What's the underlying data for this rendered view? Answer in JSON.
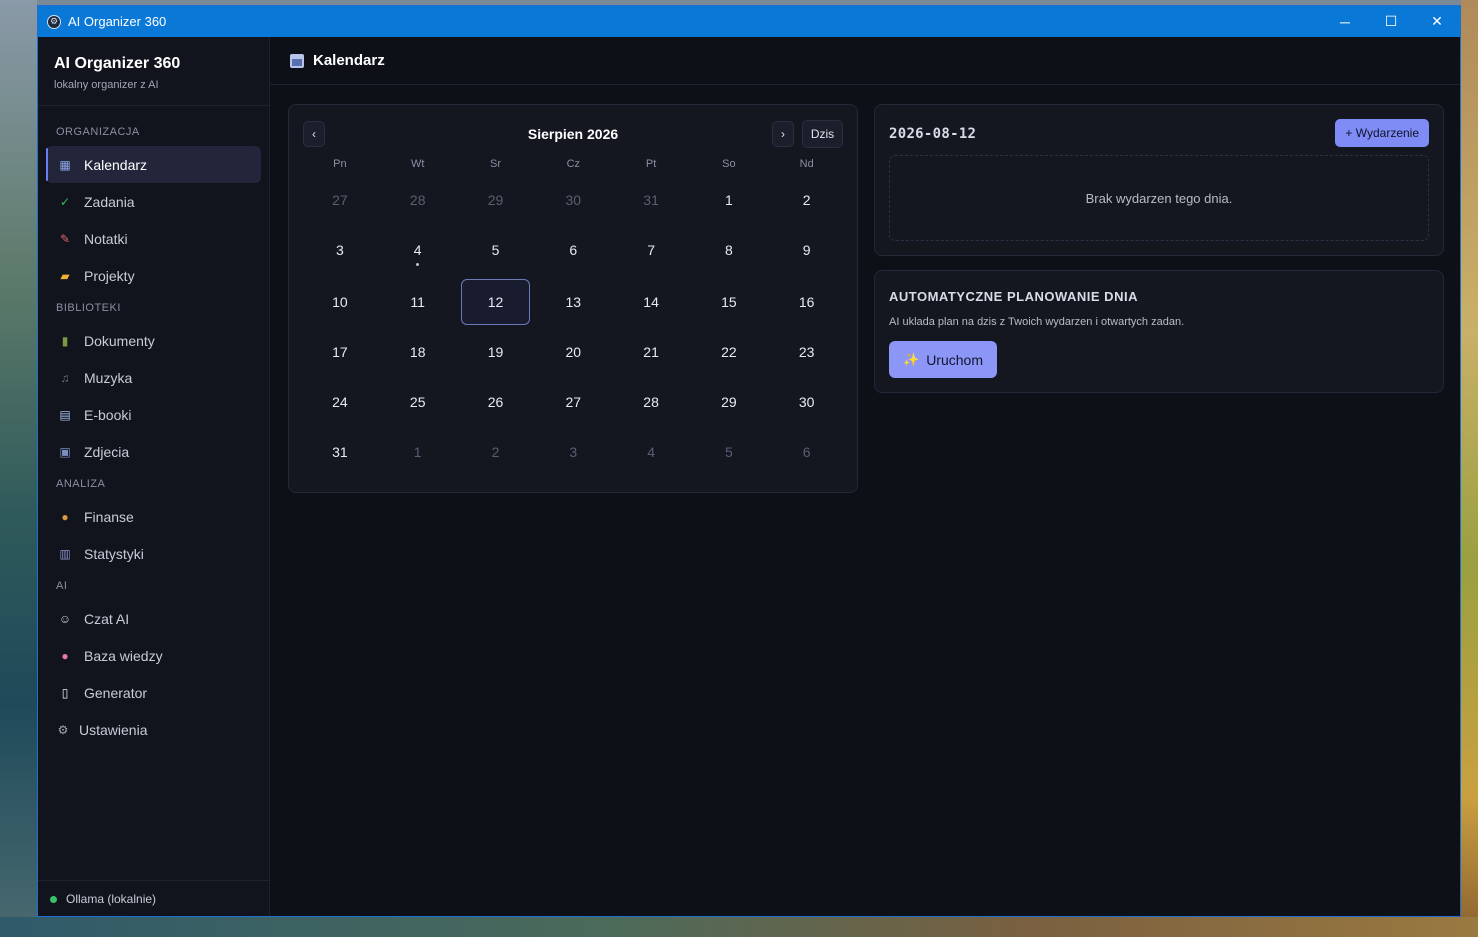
{
  "window": {
    "title": "AI Organizer 360",
    "controls": {
      "minimize": "─",
      "maximize": "☐",
      "close": "✕"
    }
  },
  "brand": {
    "name": "AI Organizer 360",
    "subtitle": "lokalny organizer z AI"
  },
  "sidebar": {
    "sections": [
      {
        "label": "ORGANIZACJA",
        "items": [
          {
            "label": "Kalendarz",
            "icon": "calendar-icon",
            "active": true
          },
          {
            "label": "Zadania",
            "icon": "checkbox-icon"
          },
          {
            "label": "Notatki",
            "icon": "memo-icon"
          },
          {
            "label": "Projekty",
            "icon": "folder-icon"
          }
        ]
      },
      {
        "label": "BIBLIOTEKI",
        "items": [
          {
            "label": "Dokumenty",
            "icon": "books-icon"
          },
          {
            "label": "Muzyka",
            "icon": "music-icon"
          },
          {
            "label": "E-booki",
            "icon": "book-icon"
          },
          {
            "label": "Zdjecia",
            "icon": "photo-icon"
          }
        ]
      },
      {
        "label": "ANALIZA",
        "items": [
          {
            "label": "Finanse",
            "icon": "money-bag-icon"
          },
          {
            "label": "Statystyki",
            "icon": "bar-chart-icon"
          }
        ]
      },
      {
        "label": "AI",
        "items": [
          {
            "label": "Czat AI",
            "icon": "robot-icon"
          },
          {
            "label": "Baza wiedzy",
            "icon": "brain-icon"
          },
          {
            "label": "Generator",
            "icon": "document-icon"
          }
        ]
      }
    ],
    "settings": {
      "label": "Ustawienia",
      "icon": "gear-icon"
    },
    "footer": {
      "status": "Ollama (lokalnie)",
      "status_color": "#35c46a"
    }
  },
  "header": {
    "title": "Kalendarz",
    "icon": "calendar-icon"
  },
  "calendar": {
    "month_title": "Sierpien 2026",
    "prev": "‹",
    "next": "›",
    "today": "Dzis",
    "weekdays": [
      "Pn",
      "Wt",
      "Sr",
      "Cz",
      "Pt",
      "So",
      "Nd"
    ],
    "days": [
      {
        "n": "27",
        "muted": true
      },
      {
        "n": "28",
        "muted": true
      },
      {
        "n": "29",
        "muted": true
      },
      {
        "n": "30",
        "muted": true
      },
      {
        "n": "31",
        "muted": true
      },
      {
        "n": "1"
      },
      {
        "n": "2"
      },
      {
        "n": "3"
      },
      {
        "n": "4",
        "event": true
      },
      {
        "n": "5"
      },
      {
        "n": "6"
      },
      {
        "n": "7"
      },
      {
        "n": "8"
      },
      {
        "n": "9"
      },
      {
        "n": "10"
      },
      {
        "n": "11"
      },
      {
        "n": "12",
        "selected": true
      },
      {
        "n": "13"
      },
      {
        "n": "14"
      },
      {
        "n": "15"
      },
      {
        "n": "16"
      },
      {
        "n": "17"
      },
      {
        "n": "18"
      },
      {
        "n": "19"
      },
      {
        "n": "20"
      },
      {
        "n": "21"
      },
      {
        "n": "22"
      },
      {
        "n": "23"
      },
      {
        "n": "24"
      },
      {
        "n": "25"
      },
      {
        "n": "26"
      },
      {
        "n": "27"
      },
      {
        "n": "28"
      },
      {
        "n": "29"
      },
      {
        "n": "30"
      },
      {
        "n": "31"
      },
      {
        "n": "1",
        "muted": true
      },
      {
        "n": "2",
        "muted": true
      },
      {
        "n": "3",
        "muted": true
      },
      {
        "n": "4",
        "muted": true
      },
      {
        "n": "5",
        "muted": true
      },
      {
        "n": "6",
        "muted": true
      }
    ]
  },
  "events": {
    "date": "2026-08-12",
    "add_label": "+ Wydarzenie",
    "empty_text": "Brak wydarzen tego dnia."
  },
  "auto_plan": {
    "title": "AUTOMATYCZNE PLANOWANIE DNIA",
    "description": "AI uklada plan na dzis z Twoich wydarzen i otwartych zadan.",
    "button_label": "Uruchom",
    "button_icon": "sparkles-icon"
  },
  "colors": {
    "accent": "#7f8cf5",
    "titlebar": "#0a78d7"
  }
}
